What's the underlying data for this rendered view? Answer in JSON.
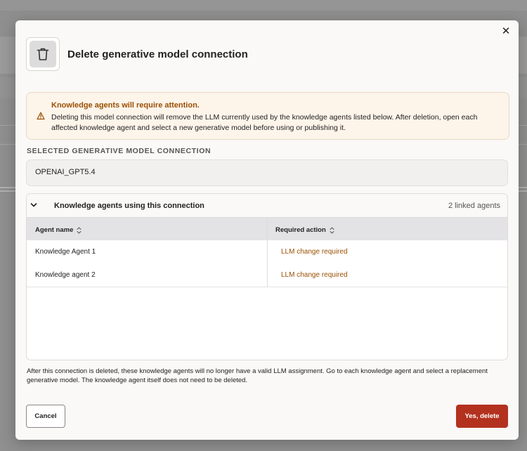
{
  "dialog": {
    "title": "Delete generative model connection",
    "close_glyph": "✕",
    "icon": "trash-icon"
  },
  "warning": {
    "title": "Knowledge agents will require attention.",
    "text": "Deleting this model connection will remove the LLM currently used by the knowledge agents listed below. After deletion, open each affected knowledge agent and select a new generative model before using or publishing it.",
    "icon": "warning-triangle-icon",
    "color": "#9a4f00"
  },
  "connection": {
    "label": "SELECTED GENERATIVE MODEL CONNECTION",
    "value": "OPENAI_GPT5.4"
  },
  "agents": {
    "title": "Knowledge agents using this connection",
    "count_text": "2 linked agents",
    "columns": [
      "Agent name",
      "Required action"
    ],
    "rows": [
      {
        "name": "Knowledge Agent 1",
        "action": "LLM change required"
      },
      {
        "name": "Knowledge agent 2",
        "action": "LLM change required"
      }
    ]
  },
  "footnote": "After this connection is deleted, these knowledge agents will no longer have a valid LLM assignment. Go to each knowledge agent and select a replacement generative model. The knowledge agent itself does not need to be deleted.",
  "buttons": {
    "cancel": "Cancel",
    "delete": "Yes, delete"
  },
  "colors": {
    "danger": "#b3311f",
    "overlay": "#8f8f8f"
  }
}
